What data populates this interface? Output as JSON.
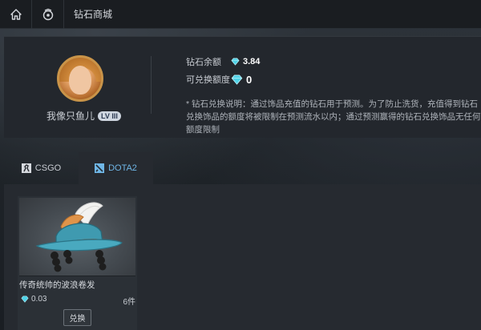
{
  "topbar": {
    "home_icon": "home-icon",
    "store_icon": "steering-icon",
    "breadcrumb": "钻石商城"
  },
  "profile": {
    "username": "我像只鱼儿",
    "level_badge": "LV III",
    "diamond_balance_label": "钻石余额",
    "diamond_balance": "3.84",
    "redeemable_label": "可兑换额度",
    "redeemable_amount": "0",
    "note": "* 钻石兑换说明：通过饰品充值的钻石用于预测。为了防止洗货，充值得到钻石兑换饰品的额度将被限制在预测流水以内；通过预测赢得的钻石兑换饰品无任何额度限制"
  },
  "tabs": [
    {
      "label": "CSGO",
      "icon": "csgo-icon",
      "active": false
    },
    {
      "label": "DOTA2",
      "icon": "dota2-icon",
      "active": true
    }
  ],
  "items": [
    {
      "title": "传奇统帅的波浪卷发",
      "price": "0.03",
      "count": "6件",
      "button_label": "兑换"
    }
  ],
  "colors": {
    "accent_blue": "#6fb6e6",
    "diamond": "#4fd3e8",
    "avatar_ring": "#c99449"
  }
}
